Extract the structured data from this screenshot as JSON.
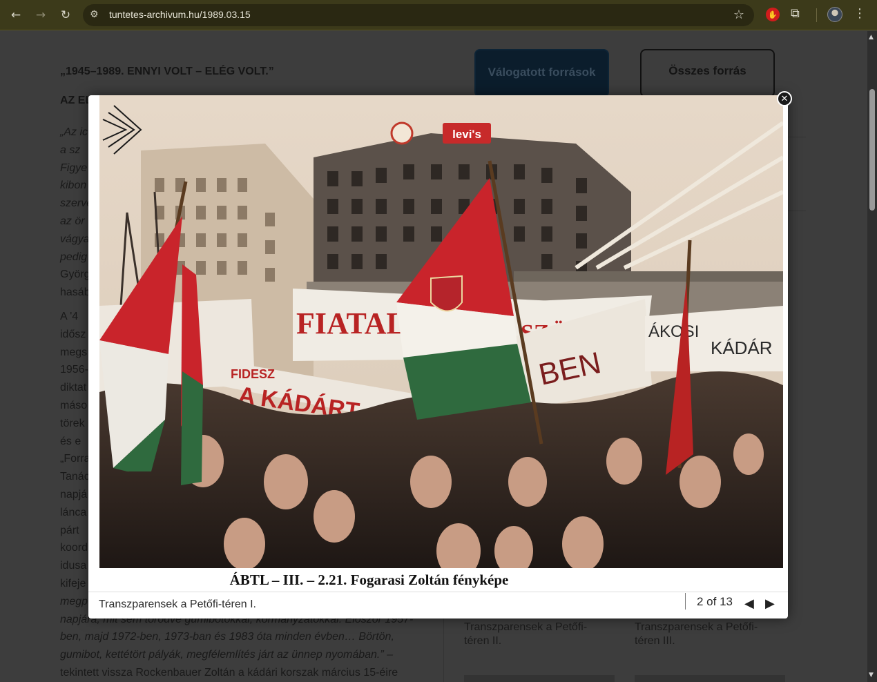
{
  "browser": {
    "back_icon": "←",
    "forward_icon": "→",
    "reload_icon": "↻",
    "tune_icon": "⚙",
    "url": "tuntetes-archivum.hu/1989.03.15",
    "star_icon": "☆",
    "extension_icon": "✋",
    "puzzle_icon": "⧉",
    "menu_icon": "⋮"
  },
  "page": {
    "heading": "„1945–1989. ENNYI VOLT – ELÉG VOLT.”",
    "subheading": "AZ EL",
    "paragraph1_lines": [
      "„Az ic",
      "a sz",
      "Figye",
      "kibon",
      "szerve",
      "az ör",
      "vágya",
      "pedig",
      "Györg",
      "hasáb"
    ],
    "paragraph2_lines": [
      "A '4",
      "idősz",
      "megs",
      "1956-",
      "diktat",
      "máso",
      "törek",
      "és e",
      "„Forra",
      "Tanác",
      "napjá",
      "lánca",
      "párt",
      "koord",
      "idusa",
      "kifeje"
    ],
    "paragraph_tail_1": "megp",
    "paragraph_tail_2": "napjára, mit sem törődve gumibotokkal, kormányzatokkal. Először 1957-",
    "paragraph_tail_3": "ben, majd 1972-ben, 1973-ban és 1983 óta minden évben… Börtön,",
    "paragraph_tail_4": "gumibot, kettétört pályák, megfélemlítés járt az ünnep nyomában.” –",
    "paragraph_tail_5": "tekintett vissza Rockenbauer Zoltán a kádári korszak március 15-éire",
    "selected_sources_button": "Válogatott források",
    "all_sources_button": "Összes forrás",
    "thumb_caption_2": "Transzparensek a Petőfi-téren II.",
    "thumb_caption_3": "Transzparensek a Petőfi-téren III."
  },
  "lightbox": {
    "scan_caption": "ÁBTL – III. – 2.21. Fogarasi Zoltán fényképe",
    "title": "Transzparensek a Petőfi-téren I.",
    "counter": "2 of 13",
    "prev_icon": "◀",
    "next_icon": "▶",
    "close_icon": "✕",
    "photo": {
      "banner_texts": [
        "FIATAL DEM",
        "SZÖVETSÉG",
        "FIDESZ",
        "A KÁDÁRT",
        "BEN",
        "ÁKOSI",
        "KÁDÁR",
        "levi's"
      ]
    }
  }
}
